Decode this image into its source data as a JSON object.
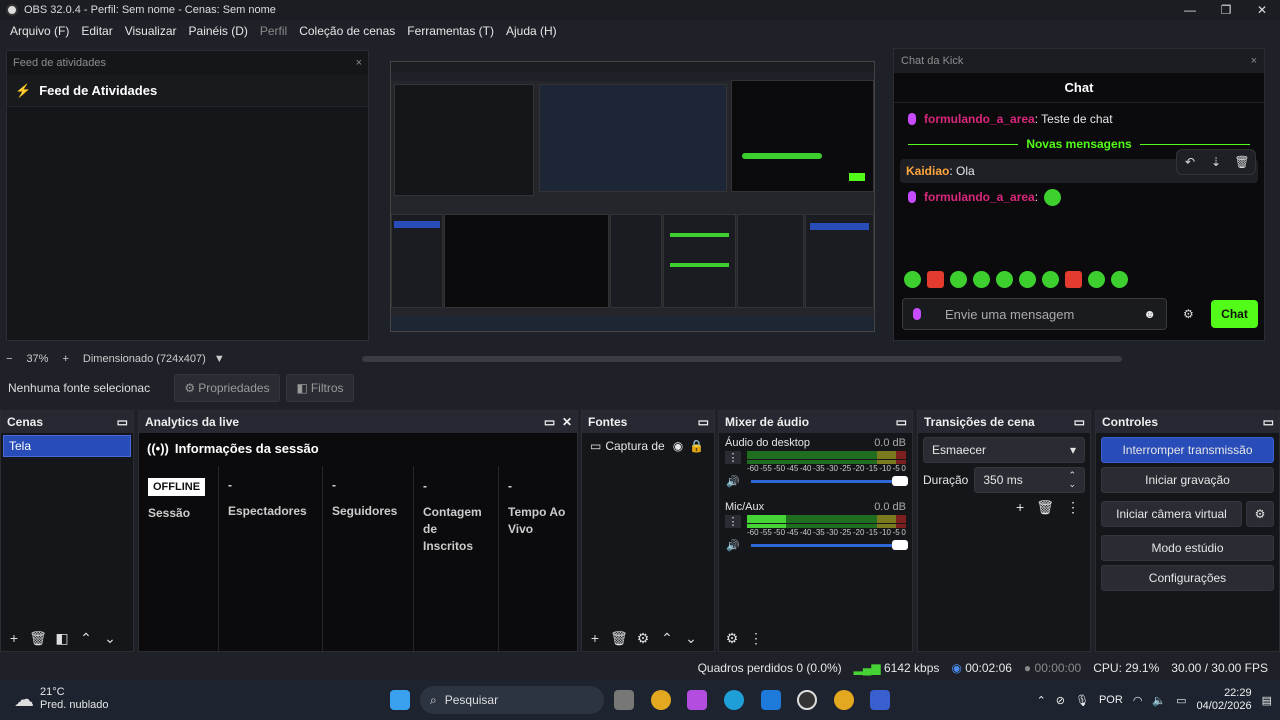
{
  "window": {
    "title": "OBS 32.0.4 - Perfil: Sem nome - Cenas: Sem nome"
  },
  "menu": [
    "Arquivo (F)",
    "Editar",
    "Visualizar",
    "Painéis (D)",
    "Perfil",
    "Coleção de cenas",
    "Ferramentas (T)",
    "Ajuda (H)"
  ],
  "feed": {
    "dock_title": "Feed de atividades",
    "heading": "Feed de Atividades"
  },
  "chat": {
    "dock_title": "Chat da Kick",
    "title": "Chat",
    "msg1_user": "formulando_a_area",
    "msg1_text": ": Teste de chat",
    "new_messages": "Novas mensagens",
    "msg2_user": "Kaidiao",
    "msg2_text": ": Ola",
    "msg3_user": "formulando_a_area",
    "msg3_text": ":",
    "input_placeholder": "Envie uma mensagem",
    "send_label": "Chat",
    "accent": "#53fc18"
  },
  "zoom": {
    "minus": "−",
    "level": "37%",
    "plus": "+",
    "size": "Dimensionado (724x407)"
  },
  "source_bar": {
    "none_selected": "Nenhuma fonte selecionac",
    "properties": "Propriedades",
    "filters": "Filtros"
  },
  "scenes": {
    "title": "Cenas",
    "items": [
      "Tela"
    ]
  },
  "analytics": {
    "title": "Analytics da live",
    "session_info": "Informações da sessão",
    "status": "OFFLINE",
    "cols": [
      {
        "value": "",
        "label": "Sessão"
      },
      {
        "value": "-",
        "label": "Espectadores"
      },
      {
        "value": "-",
        "label": "Seguidores"
      },
      {
        "value": "-",
        "label": "Contagem de Inscritos"
      },
      {
        "value": "-",
        "label": "Tempo Ao Vivo"
      }
    ]
  },
  "sources": {
    "title": "Fontes",
    "items": [
      "Captura de"
    ]
  },
  "mixer": {
    "title": "Mixer de áudio",
    "ch1_name": "Áudio do desktop",
    "ch1_db": "0.0 dB",
    "ch2_name": "Mic/Aux",
    "ch2_db": "0.0 dB",
    "ticks": [
      "-60",
      "-55",
      "-50",
      "-45",
      "-40",
      "-35",
      "-30",
      "-25",
      "-20",
      "-15",
      "-10",
      "-5",
      "0"
    ]
  },
  "transitions": {
    "title": "Transições de cena",
    "selected": "Esmaecer",
    "duration_label": "Duração",
    "duration_value": "350 ms"
  },
  "controls": {
    "title": "Controles",
    "stop_stream": "Interromper transmissão",
    "start_record": "Iniciar gravação",
    "start_virtualcam": "Iniciar câmera virtual",
    "studio_mode": "Modo estúdio",
    "settings": "Configurações"
  },
  "status": {
    "dropped_frames": "Quadros perdidos 0 (0.0%)",
    "bitrate": "6142 kbps",
    "stream_time": "00:02:06",
    "record_time": "00:00:00",
    "cpu": "CPU: 29.1%",
    "fps": "30.00 / 30.00 FPS"
  },
  "taskbar": {
    "weather_temp": "21°C",
    "weather_desc": "Pred. nublado",
    "search": "Pesquisar",
    "lang": "POR",
    "time": "22:29",
    "date": "04/02/2026"
  }
}
